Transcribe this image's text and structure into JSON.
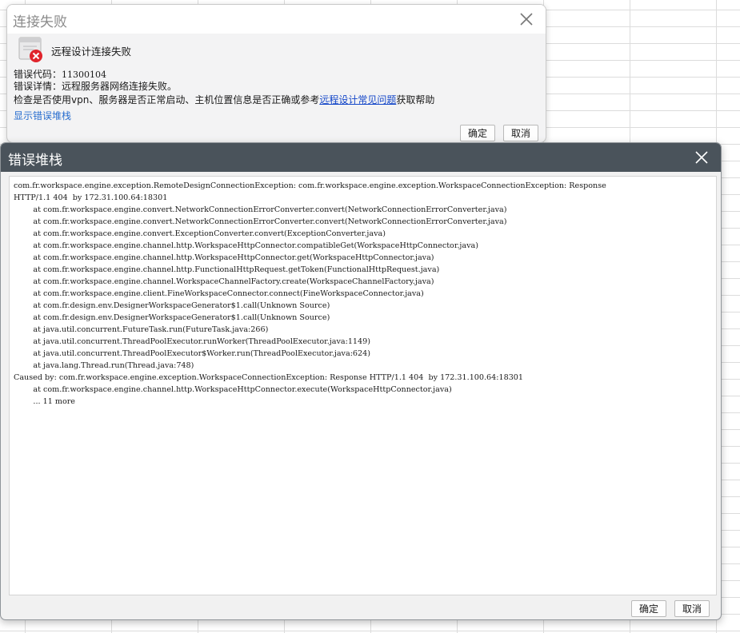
{
  "failure_dialog": {
    "title": "连接失败",
    "heading": "远程设计连接失败",
    "error_code_label": "错误代码：",
    "error_code_value": "11300104",
    "error_detail_label": "错误详情：",
    "error_detail_value": "远程服务器网络连接失败。",
    "check_prefix": "检查是否使用vpn、服务器是否正常启动、主机位置信息是否正确或参考",
    "faq_link": "远程设计常见问题",
    "check_suffix": "获取帮助",
    "show_stack_link": "显示错误堆栈",
    "ok_button": "确定",
    "cancel_button": "取消"
  },
  "stack_dialog": {
    "title": "错误堆栈",
    "ok_button": "确定",
    "cancel_button": "取消",
    "lines": [
      "com.fr.workspace.engine.exception.RemoteDesignConnectionException: com.fr.workspace.engine.exception.WorkspaceConnectionException: Response",
      "HTTP/1.1 404  by 172.31.100.64:18301",
      "        at com.fr.workspace.engine.convert.NetworkConnectionErrorConverter.convert(NetworkConnectionErrorConverter.java)",
      "        at com.fr.workspace.engine.convert.NetworkConnectionErrorConverter.convert(NetworkConnectionErrorConverter.java)",
      "        at com.fr.workspace.engine.convert.ExceptionConverter.convert(ExceptionConverter.java)",
      "        at com.fr.workspace.engine.channel.http.WorkspaceHttpConnector.compatibleGet(WorkspaceHttpConnector.java)",
      "        at com.fr.workspace.engine.channel.http.WorkspaceHttpConnector.get(WorkspaceHttpConnector.java)",
      "        at com.fr.workspace.engine.channel.http.FunctionalHttpRequest.getToken(FunctionalHttpRequest.java)",
      "        at com.fr.workspace.engine.channel.WorkspaceChannelFactory.create(WorkspaceChannelFactory.java)",
      "        at com.fr.workspace.engine.client.FineWorkspaceConnector.connect(FineWorkspaceConnector.java)",
      "        at com.fr.design.env.DesignerWorkspaceGenerator$1.call(Unknown Source)",
      "        at com.fr.design.env.DesignerWorkspaceGenerator$1.call(Unknown Source)",
      "        at java.util.concurrent.FutureTask.run(FutureTask.java:266)",
      "        at java.util.concurrent.ThreadPoolExecutor.runWorker(ThreadPoolExecutor.java:1149)",
      "        at java.util.concurrent.ThreadPoolExecutor$Worker.run(ThreadPoolExecutor.java:624)",
      "        at java.lang.Thread.run(Thread.java:748)",
      "Caused by: com.fr.workspace.engine.exception.WorkspaceConnectionException: Response HTTP/1.1 404  by 172.31.100.64:18301",
      "        at com.fr.workspace.engine.channel.http.WorkspaceHttpConnector.execute(WorkspaceHttpConnector.java)",
      "        ... 11 more"
    ]
  }
}
